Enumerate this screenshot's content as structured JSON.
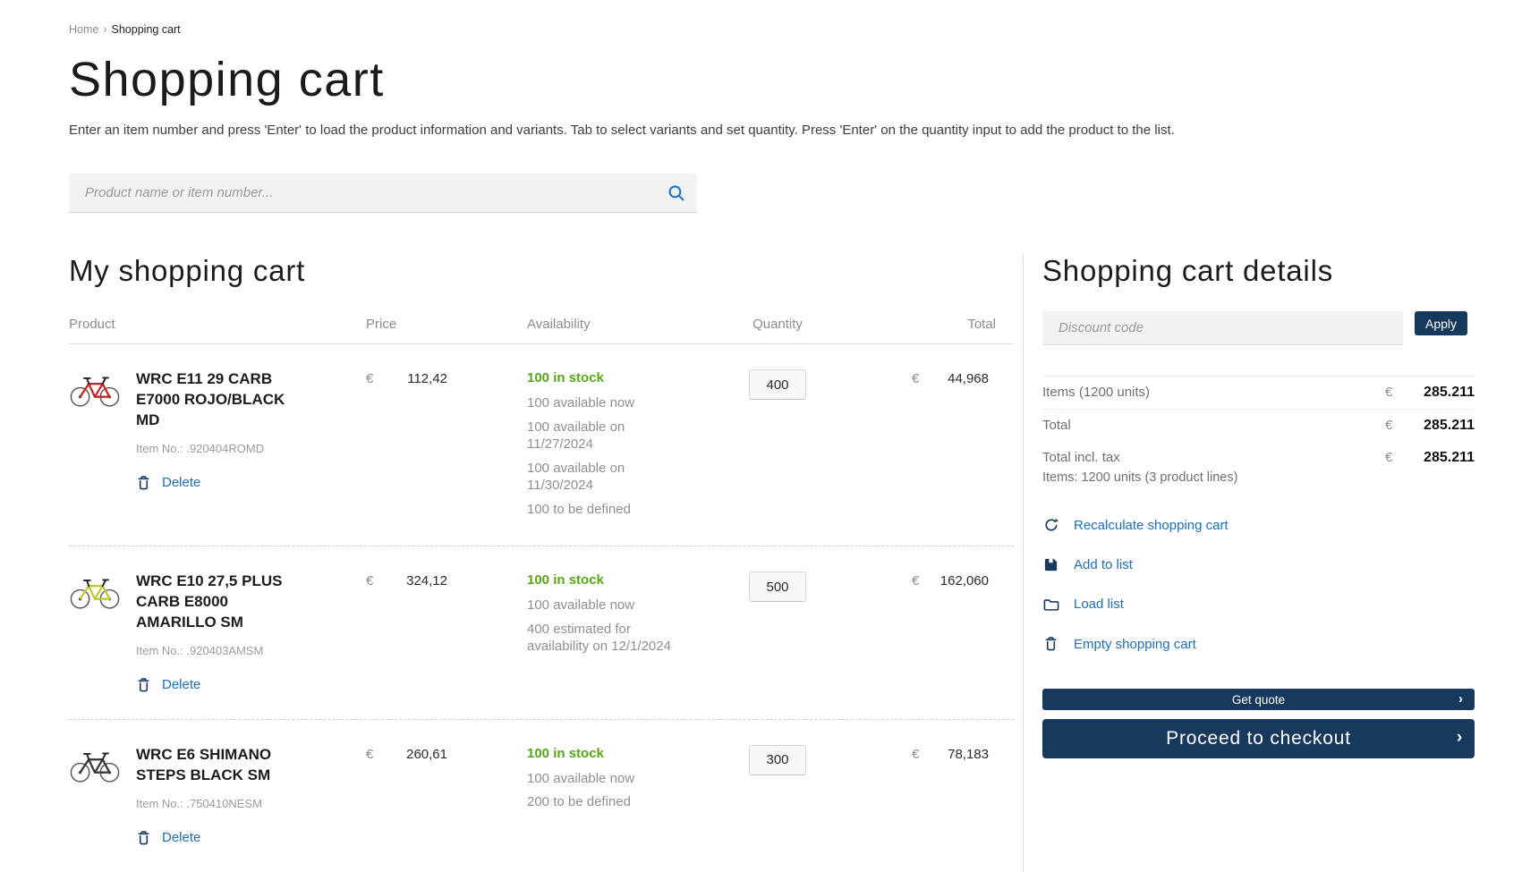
{
  "breadcrumb": {
    "home": "Home",
    "separator": "›",
    "current": "Shopping cart"
  },
  "header": {
    "title": "Shopping cart",
    "instructions": "Enter an item number and press 'Enter' to load the product information and variants. Tab to select variants and set quantity. Press 'Enter' on the quantity input to add the product to the list."
  },
  "search": {
    "placeholder": "Product name or item number...",
    "icon": "search-icon"
  },
  "cart": {
    "title": "My shopping cart",
    "currency": "€",
    "columns": {
      "product": "Product",
      "price": "Price",
      "availability": "Availability",
      "quantity": "Quantity",
      "total": "Total"
    },
    "items": [
      {
        "name": "WRC E11 29 CARB E7000 ROJO/BLACK MD",
        "item_no_label": "Item No.:",
        "item_no": ".920404ROMD",
        "delete_label": "Delete",
        "price": "112,42",
        "stock_status": "100 in stock",
        "availability_lines": [
          "100 available now",
          "100 available on 11/27/2024",
          "100 available on 11/30/2024",
          "100 to be defined"
        ],
        "quantity": "400",
        "total": "44,968",
        "bike_color": "#c62828"
      },
      {
        "name": "WRC E10 27,5 PLUS CARB E8000 AMARILLO SM",
        "item_no_label": "Item No.:",
        "item_no": ".920403AMSM",
        "delete_label": "Delete",
        "price": "324,12",
        "stock_status": "100 in stock",
        "availability_lines": [
          "100 available now",
          "400 estimated for availability on 12/1/2024"
        ],
        "quantity": "500",
        "total": "162,060",
        "bike_color": "#c0ca33"
      },
      {
        "name": "WRC E6 SHIMANO STEPS BLACK SM",
        "item_no_label": "Item No.:",
        "item_no": ".750410NESM",
        "delete_label": "Delete",
        "price": "260,61",
        "stock_status": "100 in stock",
        "availability_lines": [
          "100 available now",
          "200 to be defined"
        ],
        "quantity": "300",
        "total": "78,183",
        "bike_color": "#3a3a3a"
      }
    ]
  },
  "details": {
    "title": "Shopping cart details",
    "discount_placeholder": "Discount code",
    "apply_label": "Apply",
    "currency": "€",
    "summary": {
      "items_label": "Items (1200 units)",
      "items_value": "285.211",
      "total_label": "Total",
      "total_value": "285.211",
      "total_tax_label": "Total incl. tax",
      "total_tax_value": "285.211",
      "items_note": "Items: 1200 units (3 product lines)"
    },
    "actions": [
      {
        "icon": "refresh-icon",
        "label": "Recalculate shopping cart"
      },
      {
        "icon": "save-icon",
        "label": "Add to list"
      },
      {
        "icon": "folder-icon",
        "label": "Load list"
      },
      {
        "icon": "trash-icon",
        "label": "Empty shopping cart"
      }
    ],
    "get_quote_label": "Get quote",
    "checkout_label": "Proceed to checkout",
    "chevron": "›"
  },
  "colors": {
    "navy": "#17395E",
    "link_blue": "#1C6FB8",
    "stock_green": "#55A716",
    "search_blue": "#1E78C8"
  }
}
